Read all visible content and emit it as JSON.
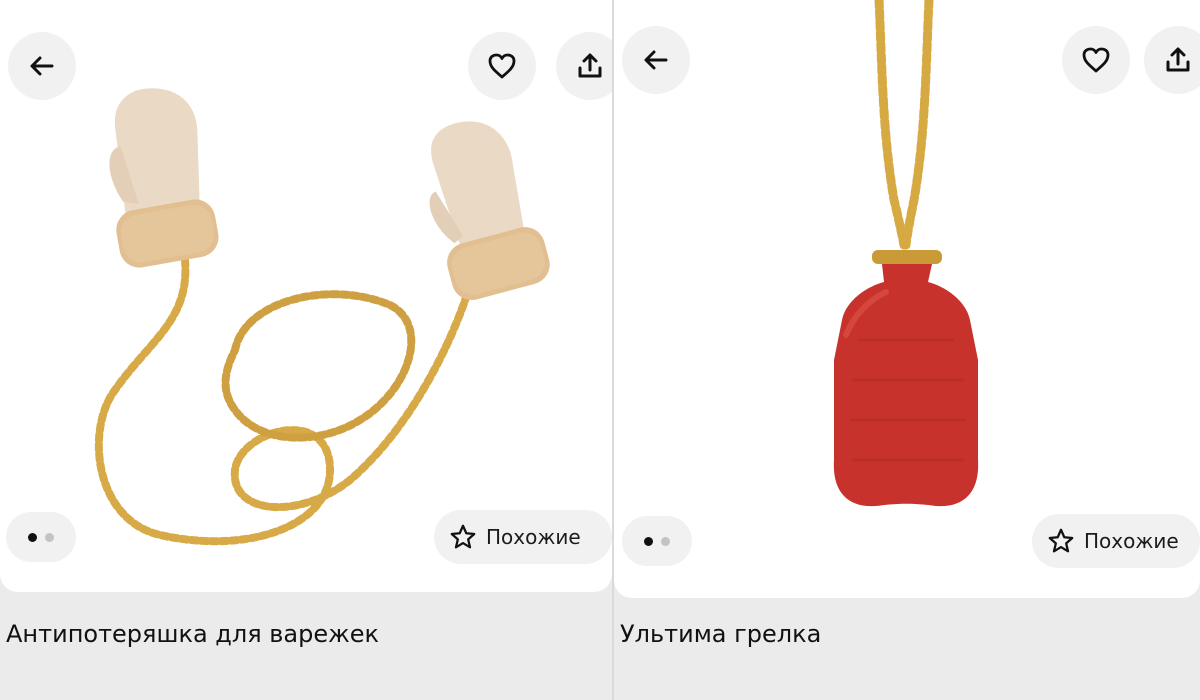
{
  "products": [
    {
      "title": "Антипотеряшка для варежек",
      "similar_label": "Похожие",
      "image_description_icon": "mittens-with-chain",
      "active_slide": 1,
      "slide_count": 2
    },
    {
      "title": "Ультима грелка",
      "similar_label": "Похожие",
      "image_description_icon": "hot-water-bottle-pendant",
      "active_slide": 1,
      "slide_count": 2
    }
  ],
  "icons": {
    "back": "arrow-left-icon",
    "favorite": "heart-icon",
    "share": "share-icon",
    "similar": "star-icon"
  },
  "colors": {
    "background": "#ebebeb",
    "card": "#ffffff",
    "button_bg": "#f1f1f1",
    "text": "#111111",
    "bottle_red": "#c8322c",
    "gold": "#d6a943",
    "mitten": "#ead9c4"
  }
}
